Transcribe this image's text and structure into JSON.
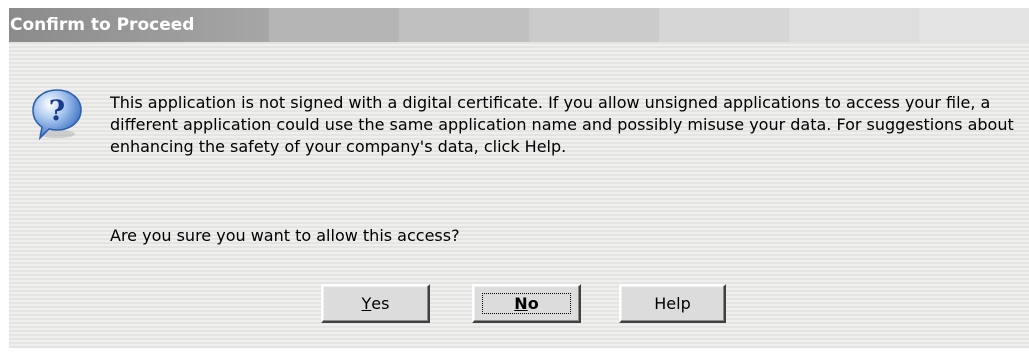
{
  "window": {
    "title": "Confirm to Proceed"
  },
  "dialog": {
    "icon": "question-icon",
    "icon_glyph": "?",
    "message": "This application is not signed with a digital certificate.  If you allow unsigned applications to access your file, a different application could use the same application name and possibly misuse your data.  For suggestions about enhancing the safety of your company's data, click Help.",
    "question": "Are you sure you want to allow this access?"
  },
  "buttons": {
    "yes": {
      "mnemonic": "Y",
      "rest": "es"
    },
    "no": {
      "mnemonic": "N",
      "rest": "o"
    },
    "help": {
      "label": "Help"
    }
  },
  "colors": {
    "icon_bubble": "#5b8fd6",
    "icon_glyph": "#1a3a8a"
  }
}
